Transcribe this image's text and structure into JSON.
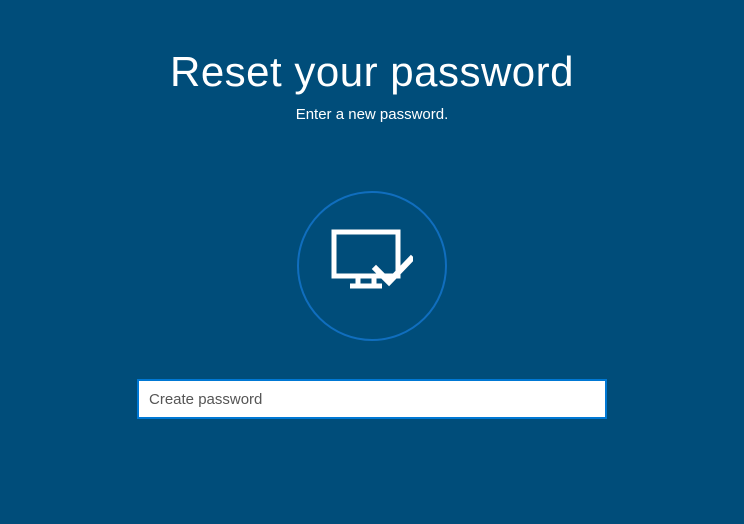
{
  "heading": "Reset your password",
  "subheading": "Enter a new password.",
  "input": {
    "placeholder": "Create password",
    "value": ""
  }
}
